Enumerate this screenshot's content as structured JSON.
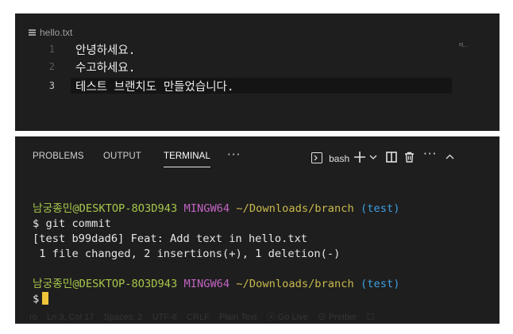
{
  "editor": {
    "tab_label": "hello.txt",
    "minimap_text": "머…",
    "lines": [
      {
        "number": "1",
        "text": "안녕하세요."
      },
      {
        "number": "2",
        "text": "수고하세요."
      },
      {
        "number": "3",
        "text": "테스트 브랜치도 만들었습니다."
      }
    ]
  },
  "panel": {
    "tabs": [
      "PROBLEMS",
      "OUTPUT",
      "TERMINAL"
    ],
    "active_tab": "TERMINAL",
    "more_label": "···",
    "shell_label": "bash",
    "icons": [
      "terminal-icon",
      "add-icon",
      "chevron-down-icon",
      "split-icon",
      "trash-icon",
      "more-icon",
      "chevron-up-icon"
    ]
  },
  "terminal": {
    "prompt1": {
      "user": "남궁종민",
      "host": "@DESKTOP-8O3D943",
      "env": "MINGW64",
      "path": "~/Downloads/branch",
      "branch": "(test)"
    },
    "command": "$ git commit",
    "output1": "[test b99dad6] Feat: Add text in hello.txt",
    "output2": " 1 file changed, 2 insertions(+), 1 deletion(-)",
    "prompt2": {
      "user": "남궁종민",
      "host": "@DESKTOP-8O3D943",
      "env": "MINGW64",
      "path": "~/Downloads/branch",
      "branch": "(test)"
    },
    "prompt_symbol": "$"
  },
  "statusbar": {
    "text": "ro    Ln 3, Col 17    Spaces: 2    UTF-8    CRLF    Plain Text    ⓐ Go Live    ⊘ Prettier    ☐"
  },
  "colors": {
    "background": "#1e1e1e",
    "user": "#a7c64a",
    "env": "#c264c2",
    "path": "#c9b94c",
    "branch": "#3c9fe0",
    "cursor": "#f0c43a"
  }
}
